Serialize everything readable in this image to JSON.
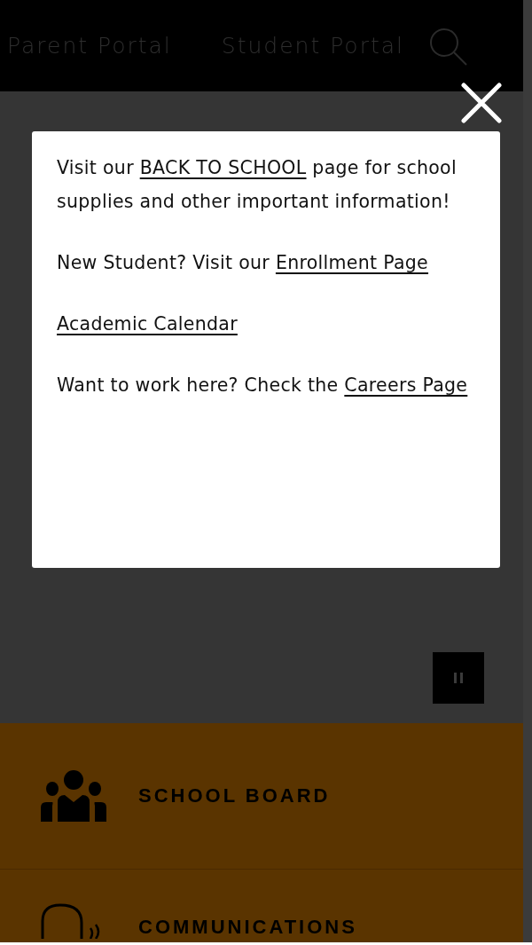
{
  "header": {
    "links": [
      {
        "label": "Parent Portal"
      },
      {
        "label": "Student Portal"
      }
    ]
  },
  "modal": {
    "paragraphs": [
      [
        {
          "kind": "text",
          "text": "Visit our "
        },
        {
          "kind": "link",
          "text": "BACK TO SCHOOL"
        },
        {
          "kind": "text",
          "text": " page for school supplies and other important information!"
        }
      ],
      [
        {
          "kind": "text",
          "text": "New Student? Visit our "
        },
        {
          "kind": "link",
          "text": "Enrollment Page"
        }
      ],
      [
        {
          "kind": "link",
          "text": "Academic Calendar"
        }
      ],
      [
        {
          "kind": "text",
          "text": "Want to work here? Check the "
        },
        {
          "kind": "link",
          "text": "Careers Page"
        }
      ]
    ]
  },
  "tiles": [
    {
      "kind": "board",
      "label": "SCHOOL BOARD"
    },
    {
      "kind": "communications",
      "label": "COMMUNICATIONS"
    }
  ]
}
